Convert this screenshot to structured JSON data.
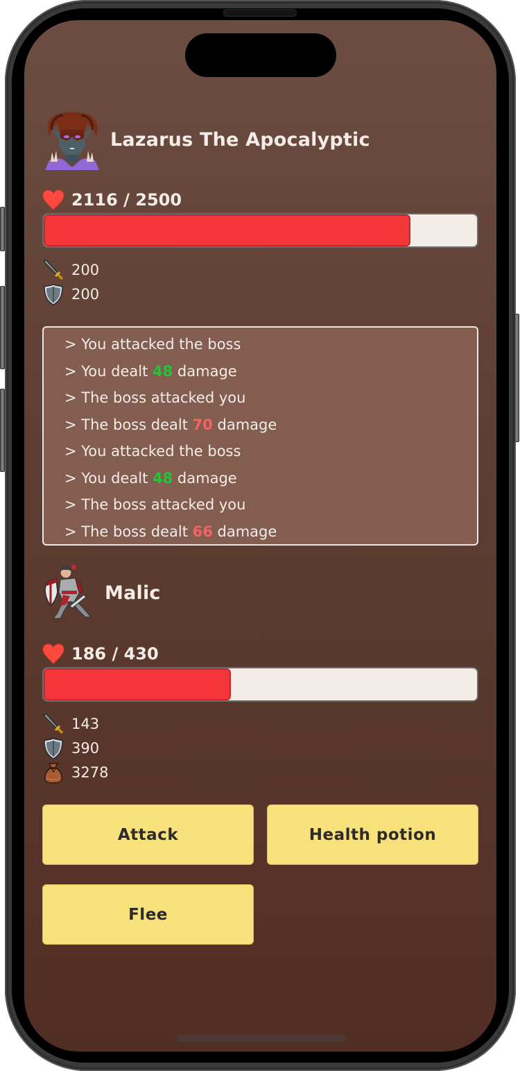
{
  "boss": {
    "name": "Lazarus The Apocalyptic",
    "avatar_icon": "demon-boss-portrait",
    "hp_current": 2116,
    "hp_max": 2500,
    "hp_text": "2116 / 2500",
    "attack": "200",
    "defense": "200"
  },
  "battle_log": {
    "partial_top_line": "> The boss dealt 70 damage",
    "lines": [
      {
        "prefix": "> You attacked the boss",
        "value": "",
        "suffix": "",
        "type": "plain"
      },
      {
        "prefix": "> You dealt ",
        "value": "48",
        "suffix": " damage",
        "type": "out"
      },
      {
        "prefix": "> The boss attacked you",
        "value": "",
        "suffix": "",
        "type": "plain"
      },
      {
        "prefix": "> The boss dealt ",
        "value": "70",
        "suffix": " damage",
        "type": "in"
      },
      {
        "prefix": "> You attacked the boss",
        "value": "",
        "suffix": "",
        "type": "plain"
      },
      {
        "prefix": "> You dealt ",
        "value": "48",
        "suffix": " damage",
        "type": "out"
      },
      {
        "prefix": "> The boss attacked you",
        "value": "",
        "suffix": "",
        "type": "plain"
      },
      {
        "prefix": "> The boss dealt ",
        "value": "66",
        "suffix": " damage",
        "type": "in"
      }
    ]
  },
  "player": {
    "name": "Malic",
    "avatar_icon": "knight-portrait",
    "hp_current": 186,
    "hp_max": 430,
    "hp_text": "186 / 430",
    "attack": "143",
    "defense": "390",
    "gold": "3278"
  },
  "actions": {
    "attack_label": "Attack",
    "health_potion_label": "Health potion",
    "flee_label": "Flee"
  },
  "colors": {
    "hp_fill": "#f4353a",
    "hp_track": "#f3ece7",
    "damage_dealt": "#28c23a",
    "damage_taken": "#f26464",
    "button_bg": "#f6e17a",
    "log_bg": "#835d50"
  }
}
